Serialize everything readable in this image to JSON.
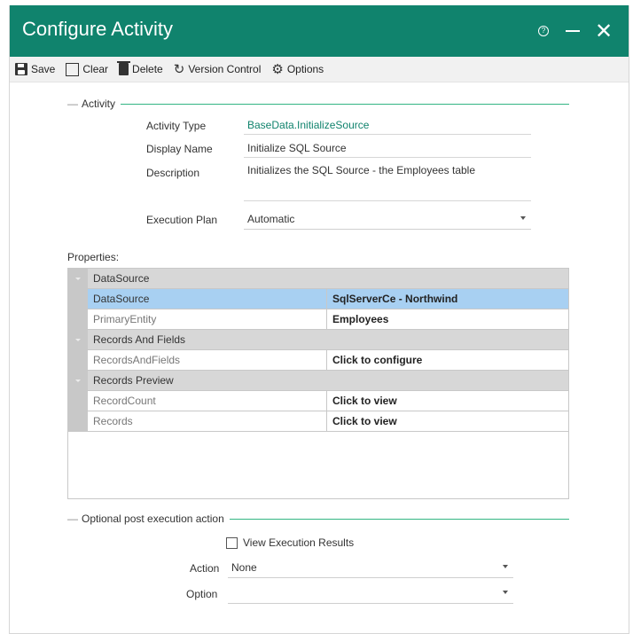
{
  "window": {
    "title": "Configure Activity"
  },
  "toolbar": {
    "save_label": "Save",
    "clear_label": "Clear",
    "delete_label": "Delete",
    "version_control_label": "Version Control",
    "options_label": "Options"
  },
  "activity": {
    "section_label": "Activity",
    "type_label": "Activity Type",
    "type_value": "BaseData.InitializeSource",
    "display_name_label": "Display Name",
    "display_name_value": "Initialize SQL Source",
    "description_label": "Description",
    "description_value": "Initializes the SQL Source - the Employees table",
    "execution_plan_label": "Execution Plan",
    "execution_plan_value": "Automatic"
  },
  "properties": {
    "label": "Properties:",
    "categories": {
      "datasource": "DataSource",
      "records_fields": "Records And Fields",
      "records_preview": "Records Preview"
    },
    "rows": {
      "datasource": {
        "name": "DataSource",
        "value": "SqlServerCe - Northwind"
      },
      "primary_entity": {
        "name": "PrimaryEntity",
        "value": "Employees"
      },
      "records_and_fields": {
        "name": "RecordsAndFields",
        "value": "Click to configure"
      },
      "record_count": {
        "name": "RecordCount",
        "value": "Click to view"
      },
      "records": {
        "name": "Records",
        "value": "Click to view"
      }
    }
  },
  "post_action": {
    "section_label": "Optional post execution action",
    "view_results_label": "View Execution Results",
    "view_results_checked": false,
    "action_label": "Action",
    "action_value": "None",
    "option_label": "Option",
    "option_value": ""
  },
  "colors": {
    "header": "#10836d",
    "section_line": "#33b583",
    "selection": "#a8d0f2"
  }
}
